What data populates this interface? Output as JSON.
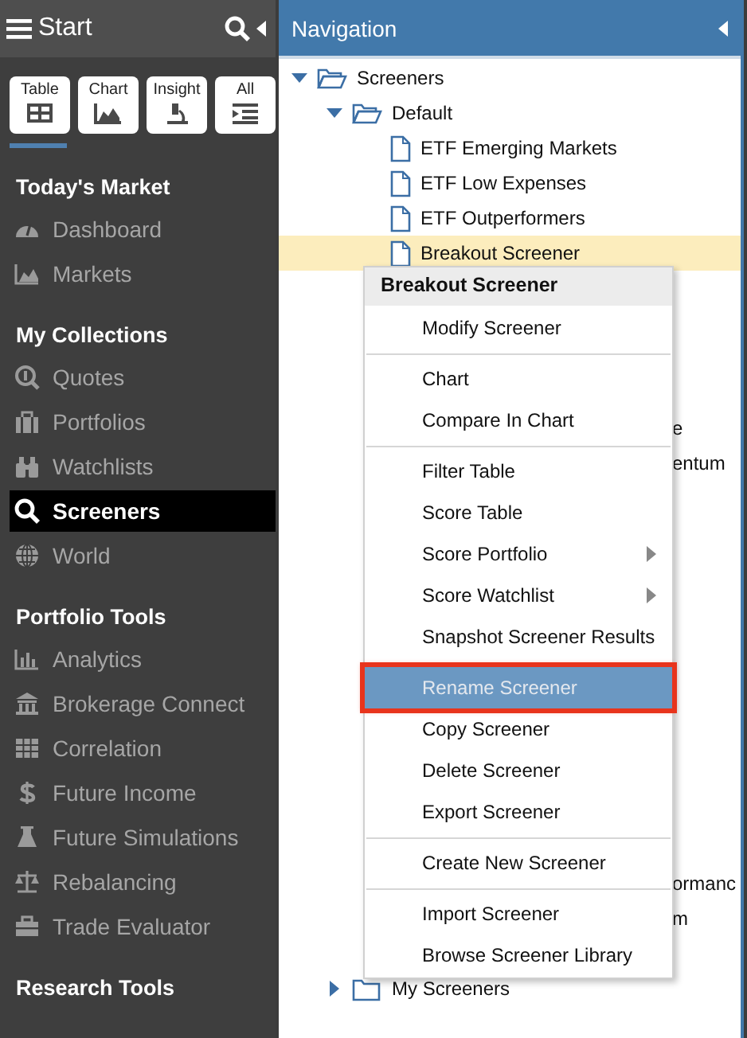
{
  "sidebar": {
    "title": "Start",
    "view_tabs": [
      {
        "label": "Table",
        "selected": true
      },
      {
        "label": "Chart",
        "selected": false
      },
      {
        "label": "Insight",
        "selected": false
      },
      {
        "label": "All",
        "selected": false
      }
    ],
    "sections": [
      {
        "heading": "Today's Market",
        "items": [
          {
            "label": "Dashboard",
            "selected": false
          },
          {
            "label": "Markets",
            "selected": false
          }
        ]
      },
      {
        "heading": "My Collections",
        "items": [
          {
            "label": "Quotes",
            "selected": false
          },
          {
            "label": "Portfolios",
            "selected": false
          },
          {
            "label": "Watchlists",
            "selected": false
          },
          {
            "label": "Screeners",
            "selected": true
          },
          {
            "label": "World",
            "selected": false
          }
        ]
      },
      {
        "heading": "Portfolio Tools",
        "items": [
          {
            "label": "Analytics",
            "selected": false
          },
          {
            "label": "Brokerage Connect",
            "selected": false
          },
          {
            "label": "Correlation",
            "selected": false
          },
          {
            "label": "Future Income",
            "selected": false
          },
          {
            "label": "Future Simulations",
            "selected": false
          },
          {
            "label": "Rebalancing",
            "selected": false
          },
          {
            "label": "Trade Evaluator",
            "selected": false
          }
        ]
      },
      {
        "heading": "Research Tools"
      }
    ]
  },
  "navigation": {
    "title": "Navigation",
    "tree": [
      {
        "label": "Screeners",
        "expanded": true,
        "children": [
          {
            "label": "Default",
            "expanded": true,
            "children": [
              {
                "label": "ETF Emerging Markets",
                "selected": false,
                "covered": false
              },
              {
                "label": "ETF Low Expenses",
                "selected": false,
                "covered": false
              },
              {
                "label": "ETF Outperformers",
                "selected": false,
                "covered": false
              },
              {
                "label": "Breakout Screener",
                "selected": true,
                "covered": false
              },
              {
                "label": "e",
                "selected": false,
                "covered": true
              },
              {
                "label": "entum",
                "selected": false,
                "covered": true
              },
              {
                "label": "ormanc",
                "selected": false,
                "covered": true
              },
              {
                "label": "m",
                "selected": false,
                "covered": true
              }
            ]
          },
          {
            "label": "My Screeners",
            "expanded": false
          }
        ]
      }
    ]
  },
  "context_menu": {
    "title": "Breakout Screener",
    "groups": [
      [
        {
          "label": "Modify Screener",
          "selected": false,
          "has_submenu": false,
          "outlined": false
        }
      ],
      [
        {
          "label": "Chart",
          "selected": false,
          "has_submenu": false,
          "outlined": false
        },
        {
          "label": "Compare In Chart",
          "selected": false,
          "has_submenu": false,
          "outlined": false
        }
      ],
      [
        {
          "label": "Filter Table",
          "selected": false,
          "has_submenu": false,
          "outlined": false
        },
        {
          "label": "Score Table",
          "selected": false,
          "has_submenu": false,
          "outlined": false
        },
        {
          "label": "Score Portfolio",
          "selected": false,
          "has_submenu": true,
          "outlined": false
        },
        {
          "label": "Score Watchlist",
          "selected": false,
          "has_submenu": true,
          "outlined": false
        },
        {
          "label": "Snapshot Screener Results",
          "selected": false,
          "has_submenu": false,
          "outlined": false
        }
      ],
      [
        {
          "label": "Rename Screener",
          "selected": true,
          "has_submenu": false,
          "outlined": true
        },
        {
          "label": "Copy Screener",
          "selected": false,
          "has_submenu": false,
          "outlined": false
        },
        {
          "label": "Delete Screener",
          "selected": false,
          "has_submenu": false,
          "outlined": false
        },
        {
          "label": "Export Screener",
          "selected": false,
          "has_submenu": false,
          "outlined": false
        }
      ],
      [
        {
          "label": "Create New Screener",
          "selected": false,
          "has_submenu": false,
          "outlined": false
        }
      ],
      [
        {
          "label": "Import Screener",
          "selected": false,
          "has_submenu": false,
          "outlined": false
        },
        {
          "label": "Browse Screener Library",
          "selected": false,
          "has_submenu": false,
          "outlined": false
        }
      ]
    ]
  }
}
